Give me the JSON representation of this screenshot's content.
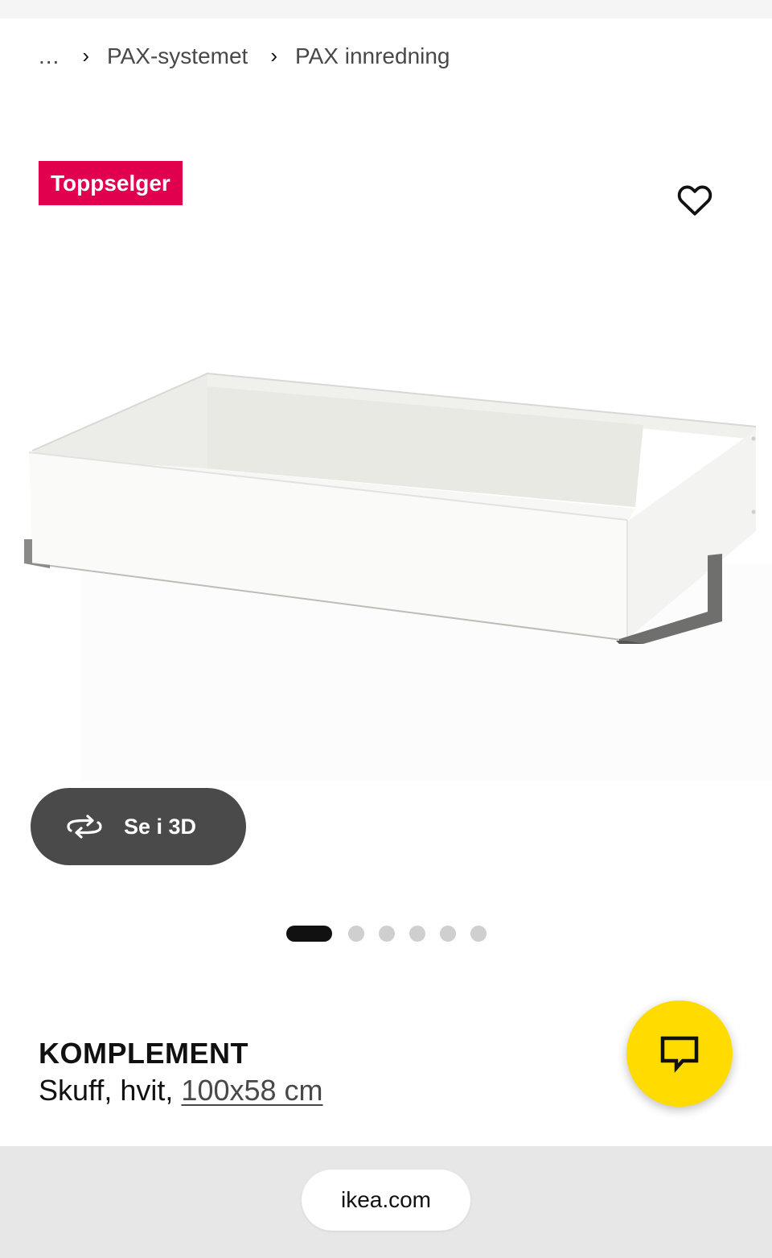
{
  "breadcrumb": {
    "ellipsis": "...",
    "items": [
      {
        "label": "PAX-systemet"
      },
      {
        "label": "PAX innredning"
      }
    ]
  },
  "badge": {
    "label": "Toppselger",
    "color": "#e0004d"
  },
  "favorite": {
    "icon": "heart-outline-icon"
  },
  "viewer": {
    "label": "Se i 3D",
    "icon": "rotate-3d-icon"
  },
  "carousel": {
    "total": 6,
    "active_index": 0
  },
  "product": {
    "name": "KOMPLEMENT",
    "description": "Skuff, hvit, ",
    "size": "100x58 cm"
  },
  "chat": {
    "icon": "chat-bubble-icon",
    "color": "#ffdb00"
  },
  "browser": {
    "url": "ikea.com"
  }
}
